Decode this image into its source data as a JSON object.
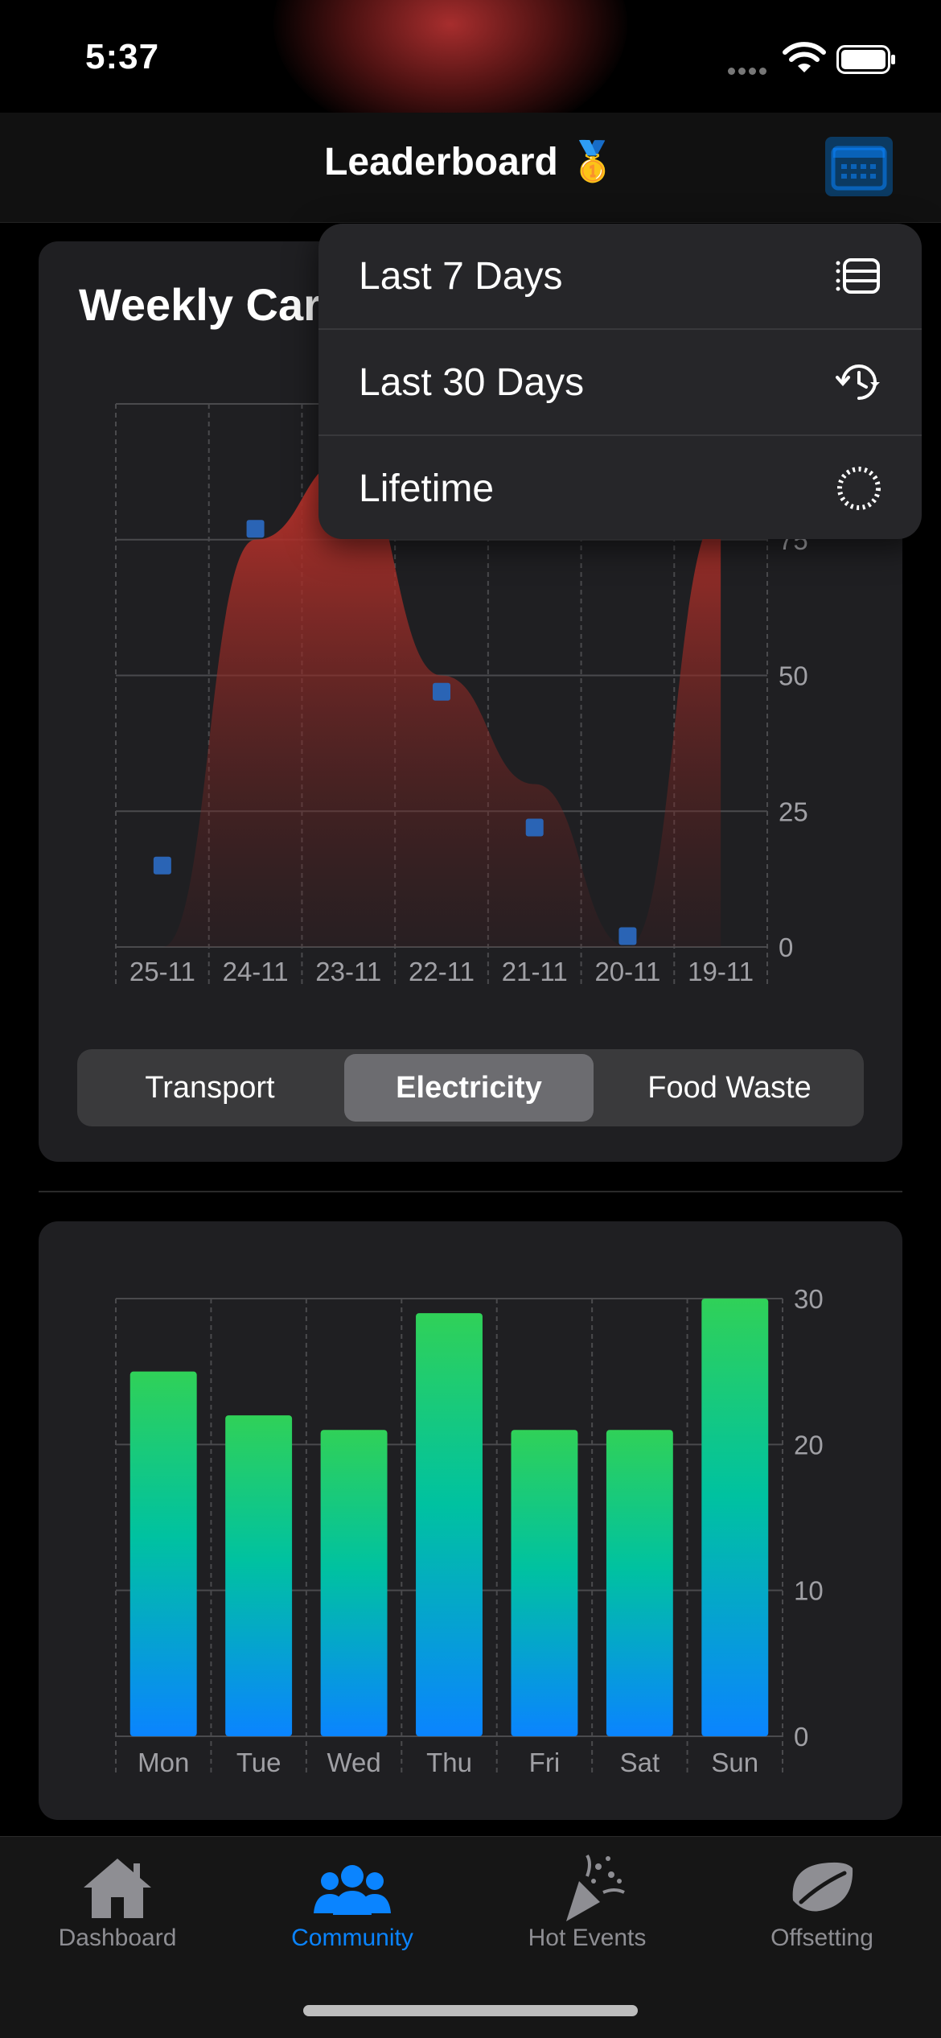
{
  "status_bar": {
    "time": "5:37"
  },
  "nav": {
    "title": "Leaderboard 🥇"
  },
  "line_card": {
    "title": "Weekly Carbon Footprint",
    "segments": [
      "Transport",
      "Electricity",
      "Food Waste"
    ],
    "selected_segment": "Electricity"
  },
  "dropdown": {
    "items": [
      {
        "label": "Last 7 Days",
        "icon": "list-icon"
      },
      {
        "label": "Last 30 Days",
        "icon": "history-icon"
      },
      {
        "label": "Lifetime",
        "icon": "circle-dashed-icon"
      }
    ]
  },
  "chart_data": [
    {
      "type": "area",
      "x_labels": [
        "25-11",
        "24-11",
        "23-11",
        "22-11",
        "21-11",
        "20-11",
        "19-11"
      ],
      "area_values": [
        0,
        75,
        90,
        50,
        30,
        0,
        80
      ],
      "point_values": [
        15,
        77,
        null,
        47,
        22,
        2,
        null
      ],
      "y_ticks": [
        0,
        25,
        50,
        75
      ],
      "ylim": [
        0,
        100
      ],
      "colors": {
        "area": "#c0332b",
        "points": "#2a64b5"
      }
    },
    {
      "type": "bar",
      "categories": [
        "Mon",
        "Tue",
        "Wed",
        "Thu",
        "Fri",
        "Sat",
        "Sun"
      ],
      "values": [
        25,
        22,
        21,
        29,
        21,
        21,
        30
      ],
      "y_ticks": [
        0,
        10,
        20,
        30
      ],
      "ylim": [
        0,
        30
      ],
      "colors": {
        "top": "#30d158",
        "bottom": "#0a84ff"
      }
    }
  ],
  "tabs": [
    {
      "label": "Dashboard",
      "icon": "house-icon",
      "active": false
    },
    {
      "label": "Community",
      "icon": "people-icon",
      "active": true
    },
    {
      "label": "Hot Events",
      "icon": "party-popper-icon",
      "active": false
    },
    {
      "label": "Offsetting",
      "icon": "leaf-icon",
      "active": false
    }
  ],
  "colors": {
    "accent": "#0a84ff",
    "card": "#1f1f22",
    "menu": "#262629"
  }
}
